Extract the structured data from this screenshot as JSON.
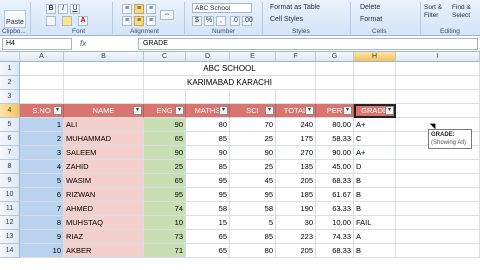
{
  "ribbon": {
    "paste_label": "Paste",
    "clipboard_label": "Clipbo...",
    "font_label": "Font",
    "alignment_label": "Alignment",
    "number_label": "Number",
    "styles_label": "Styles",
    "cells_label": "Cells",
    "editing_label": "Editing",
    "bold": "B",
    "italic": "I",
    "underline": "U",
    "number_format": "ABC School",
    "percent": "%",
    "format_as_table": "Format as Table",
    "cell_styles": "Cell Styles",
    "delete": "Delete",
    "format": "Format",
    "sort_filter": "Sort & Filter",
    "find_select": "Find & Select"
  },
  "formula_bar": {
    "name_box": "H4",
    "fx": "fx",
    "content": "GRADE"
  },
  "columns": [
    "A",
    "B",
    "C",
    "D",
    "E",
    "F",
    "G",
    "H",
    "I"
  ],
  "rows": [
    "1",
    "2",
    "3",
    "4",
    "5",
    "6",
    "7",
    "8",
    "9",
    "10",
    "11",
    "12",
    "13",
    "14"
  ],
  "title1": "ABC SCHOOL",
  "title2": "KARIMABAD KARACHI",
  "headers": [
    "S.NO",
    "NAME",
    "ENG",
    "MATHS",
    "SCI",
    "TOTAL",
    "PER",
    "GRADE"
  ],
  "filter_glyph": "▾",
  "data": [
    [
      "1",
      "ALI",
      "90",
      "80",
      "70",
      "240",
      "80.00",
      "A+"
    ],
    [
      "2",
      "MUHAMMAD",
      "65",
      "85",
      "25",
      "175",
      "58.33",
      "C"
    ],
    [
      "3",
      "SALEEM",
      "90",
      "90",
      "90",
      "270",
      "90.00",
      "A+"
    ],
    [
      "4",
      "ZAHID",
      "25",
      "85",
      "25",
      "135",
      "45.00",
      "D"
    ],
    [
      "5",
      "WASIM",
      "65",
      "95",
      "45",
      "205",
      "68.33",
      "B"
    ],
    [
      "6",
      "RIZWAN",
      "95",
      "95",
      "95",
      "185",
      "61.67",
      "B"
    ],
    [
      "7",
      "AHMED",
      "74",
      "58",
      "58",
      "190",
      "63.33",
      "B"
    ],
    [
      "8",
      "MUHSTAQ",
      "10",
      "15",
      "5",
      "30",
      "10.00",
      "FAIL"
    ],
    [
      "9",
      "RIAZ",
      "73",
      "65",
      "85",
      "223",
      "74.33",
      "A"
    ],
    [
      "10",
      "AKBER",
      "71",
      "65",
      "80",
      "205",
      "68.33",
      "B"
    ]
  ],
  "tooltip": {
    "line1": "GRADE:",
    "line2": "(Showing All)"
  }
}
